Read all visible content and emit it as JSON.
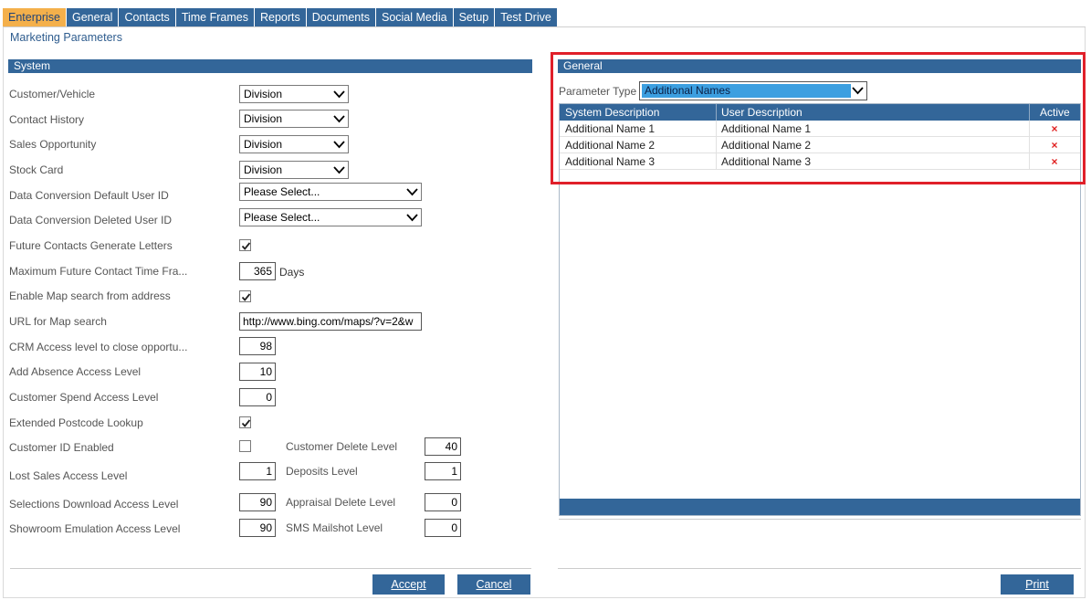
{
  "tabs": [
    "Enterprise",
    "General",
    "Contacts",
    "Time Frames",
    "Reports",
    "Documents",
    "Social Media",
    "Setup",
    "Test Drive"
  ],
  "page_title": "Marketing Parameters",
  "system": {
    "header": "System",
    "customer_vehicle": {
      "label": "Customer/Vehicle",
      "value": "Division"
    },
    "contact_history": {
      "label": "Contact History",
      "value": "Division"
    },
    "sales_opportunity": {
      "label": "Sales Opportunity",
      "value": "Division"
    },
    "stock_card": {
      "label": "Stock Card",
      "value": "Division"
    },
    "dc_default_user": {
      "label": "Data Conversion Default User ID",
      "value": "Please Select..."
    },
    "dc_deleted_user": {
      "label": "Data Conversion Deleted User ID",
      "value": "Please Select..."
    },
    "future_contacts_letters": {
      "label": "Future Contacts Generate Letters",
      "checked": true
    },
    "max_future_contact": {
      "label": "Maximum Future Contact Time Fra...",
      "value": "365",
      "unit": "Days"
    },
    "enable_map_search": {
      "label": "Enable Map search from address",
      "checked": true
    },
    "url_map_search": {
      "label": "URL for Map search",
      "value": "http://www.bing.com/maps/?v=2&w"
    },
    "crm_access_close": {
      "label": "CRM Access level to close opportu...",
      "value": "98"
    },
    "add_absence": {
      "label": "Add Absence Access Level",
      "value": "10"
    },
    "customer_spend": {
      "label": "Customer Spend Access Level",
      "value": "0"
    },
    "extended_postcode": {
      "label": "Extended Postcode Lookup",
      "checked": true
    },
    "customer_id_enabled": {
      "label": "Customer ID Enabled",
      "checked": false
    },
    "customer_delete_level": {
      "label": "Customer Delete Level",
      "value": "40"
    },
    "lost_sales": {
      "label": "Lost Sales Access Level",
      "value": "1"
    },
    "deposits_level": {
      "label": "Deposits Level",
      "value": "1"
    },
    "selections_download": {
      "label": "Selections Download Access Level",
      "value": "90"
    },
    "appraisal_delete": {
      "label": "Appraisal Delete Level",
      "value": "0"
    },
    "showroom_emulation": {
      "label": "Showroom Emulation Access Level",
      "value": "90"
    },
    "sms_mailshot": {
      "label": "SMS Mailshot Level",
      "value": "0"
    }
  },
  "buttons": {
    "accept": "Accept",
    "cancel": "Cancel",
    "print": "Print"
  },
  "general": {
    "header": "General",
    "param_type_label": "Parameter Type",
    "param_type_value": "Additional Names",
    "columns": [
      "System Description",
      "User Description",
      "Active"
    ],
    "rows": [
      {
        "system": "Additional Name 1",
        "user": "Additional Name 1",
        "active": "×"
      },
      {
        "system": "Additional Name 2",
        "user": "Additional Name 2",
        "active": "×"
      },
      {
        "system": "Additional Name 3",
        "user": "Additional Name 3",
        "active": "×"
      }
    ]
  },
  "colors": {
    "header_blue": "#336699",
    "active_tab": "#f4b04b",
    "highlight_red": "#e0202a",
    "inactive_x": "#e02020"
  }
}
